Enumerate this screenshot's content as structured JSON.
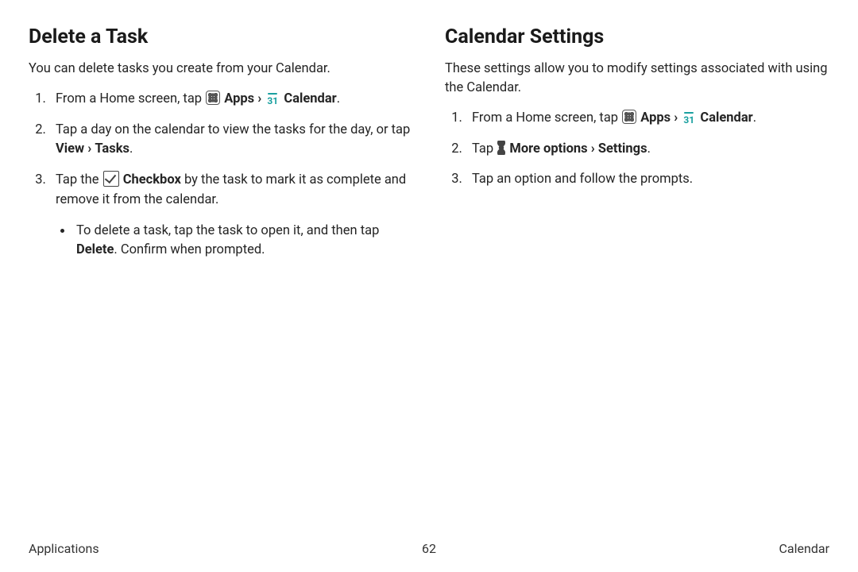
{
  "left": {
    "heading": "Delete a Task",
    "intro": "You can delete tasks you create from your Calendar.",
    "step1_prefix": "From a Home screen, tap ",
    "apps_label": "Apps",
    "chevron": "›",
    "calendar_label": "Calendar",
    "calendar_day": "31",
    "period": ".",
    "step2_before": "Tap a day on the calendar to view the tasks for the day, or tap ",
    "step2_bold1": "View",
    "step2_bold2": "Tasks",
    "step3_before": "Tap the ",
    "step3_bold": "Checkbox",
    "step3_after": " by the task to mark it as complete and remove it from the calendar.",
    "bullet_before": "To delete a task, tap the task to open it, and then tap ",
    "bullet_bold": "Delete",
    "bullet_after": ". Confirm when prompted."
  },
  "right": {
    "heading": "Calendar Settings",
    "intro": "These settings allow you to modify settings associated with using the Calendar.",
    "step1_prefix": "From a Home screen, tap ",
    "apps_label": "Apps",
    "chevron": "›",
    "calendar_label": "Calendar",
    "calendar_day": "31",
    "period": ".",
    "step2_prefix": "Tap ",
    "step2_bold1": "More options",
    "step2_bold2": "Settings",
    "step3": "Tap an option and follow the prompts."
  },
  "footer": {
    "left": "Applications",
    "center": "62",
    "right": "Calendar"
  }
}
